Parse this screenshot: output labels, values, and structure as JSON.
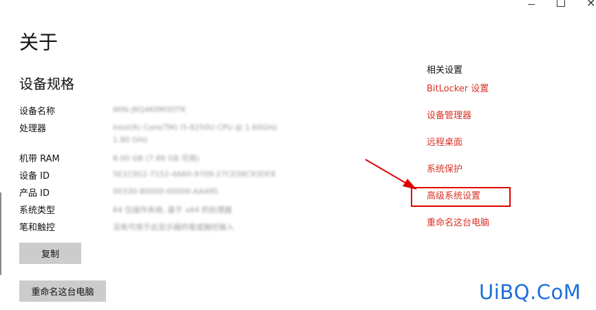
{
  "window": {
    "minimize_icon": "minimize-icon",
    "maximize_icon": "maximize-icon",
    "close_icon": "close-icon",
    "close_glyph": "×"
  },
  "page_title": "关于",
  "device_specs": {
    "title": "设备规格",
    "rows": [
      {
        "label": "设备名称",
        "value": "WIN-J6Q4K0M3DTK"
      },
      {
        "label": "处理器",
        "value": "Intel(R) Core(TM) i5-8250U CPU @ 1.60GHz",
        "value2": "1.80 GHz"
      },
      {
        "label": "机带 RAM",
        "value": "8.00 GB (7.88 GB 可用)"
      },
      {
        "label": "设备 ID",
        "value": "5E1C952-7152-4A60-9709-27C038C93DF8"
      },
      {
        "label": "产品 ID",
        "value": "00330-80000-00000-AA495"
      },
      {
        "label": "系统类型",
        "value": "64 位操作系统, 基于 x64 的处理器"
      },
      {
        "label": "笔和触控",
        "value": "没有可用于此显示器的笔或触控输入"
      }
    ],
    "copy_button": "复制",
    "rename_button": "重命名这台电脑"
  },
  "related_settings": {
    "title": "相关设置",
    "links": [
      "BitLocker 设置",
      "设备管理器",
      "远程桌面",
      "系统保护",
      "高级系统设置",
      "重命名这台电脑"
    ],
    "highlighted_index": 4
  },
  "watermark": "UiBQ.CoM",
  "colors": {
    "link": "#d93025",
    "annotation": "#e00000",
    "button_bg": "#cccccc",
    "watermark": "#1e6fd9"
  }
}
